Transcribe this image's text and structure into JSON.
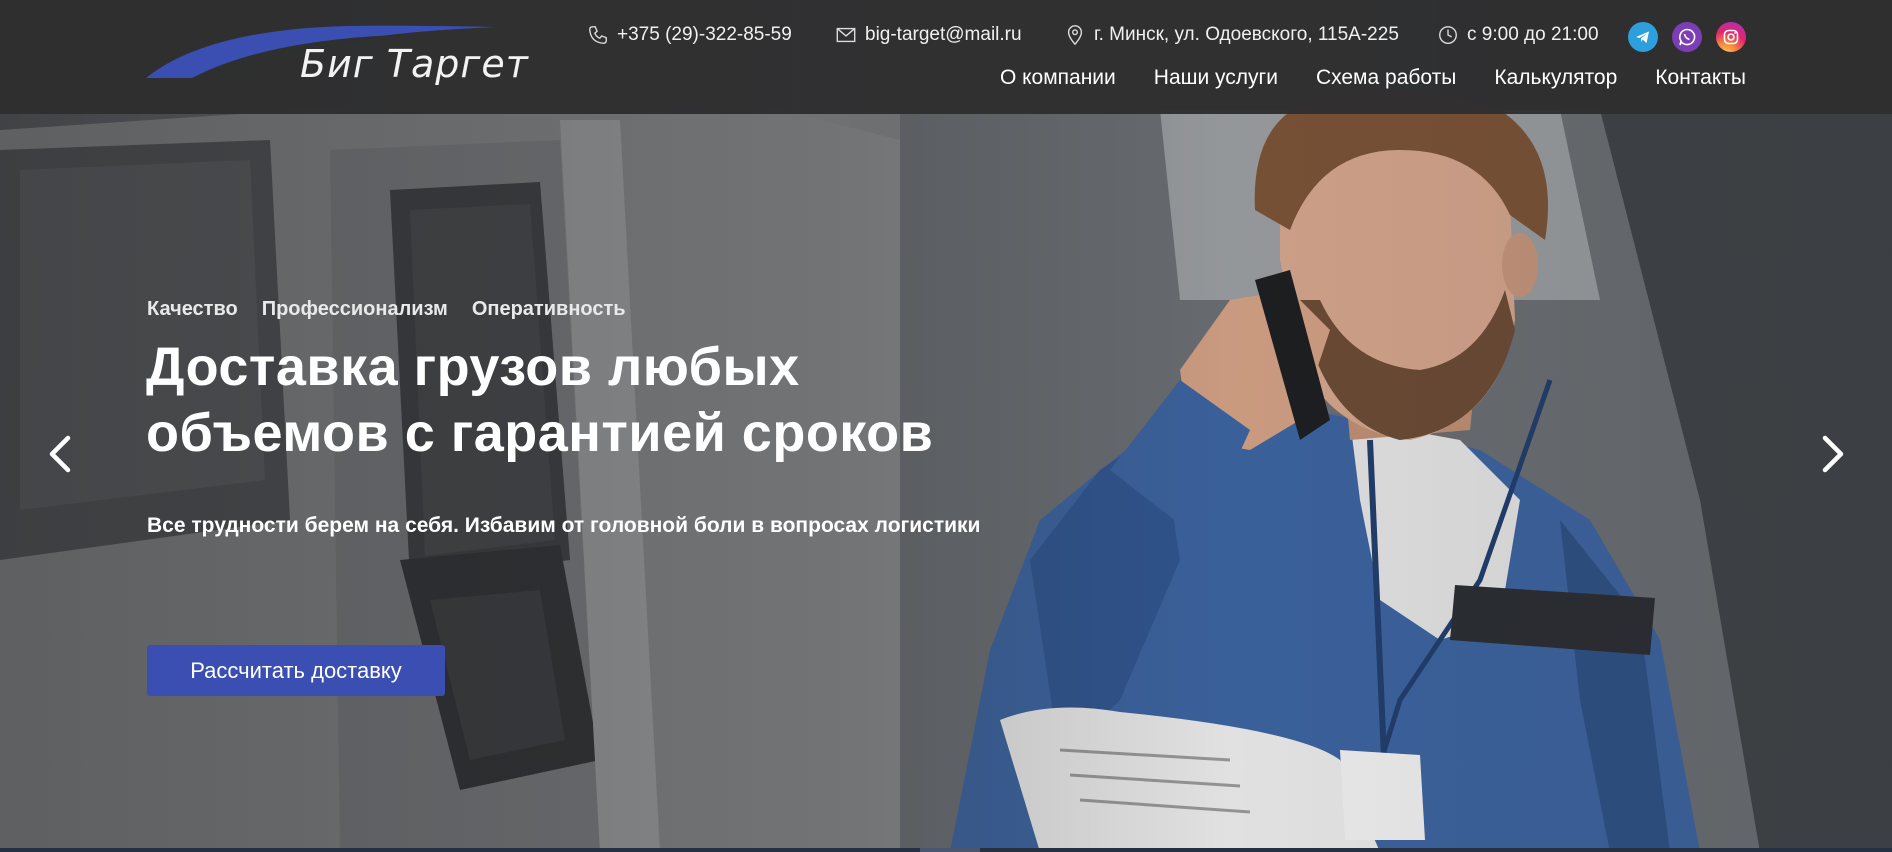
{
  "brand": {
    "name": "Биг Таргет",
    "accent_color": "#3a4fb1"
  },
  "contacts": {
    "phone": "+375 (29)-322-85-59",
    "email": "big-target@mail.ru",
    "address": "г. Минск, ул. Одоевского, 115А-225",
    "hours": "с 9:00 до 21:00",
    "icons": [
      "phone-icon",
      "mail-icon",
      "location-pin-icon",
      "clock-icon"
    ]
  },
  "social": [
    {
      "name": "telegram",
      "color": "#2c9fdc"
    },
    {
      "name": "viber",
      "color": "#7d3db4"
    },
    {
      "name": "instagram",
      "color": "#e3266c"
    }
  ],
  "nav": {
    "items": [
      "О компании",
      "Наши услуги",
      "Схема работы",
      "Калькулятор",
      "Контакты"
    ]
  },
  "hero": {
    "tags": [
      "Качество",
      "Профессионализм",
      "Оперативность"
    ],
    "title_line1": "Доставка грузов любых",
    "title_line2": "объемов с гарантией сроков",
    "subtitle": "Все трудности берем на себя. Избавим от головной боли в вопросах логистики",
    "cta_label": "Рассчитать доставку"
  },
  "carousel": {
    "prev_icon": "chevron-left-icon",
    "next_icon": "chevron-right-icon"
  }
}
